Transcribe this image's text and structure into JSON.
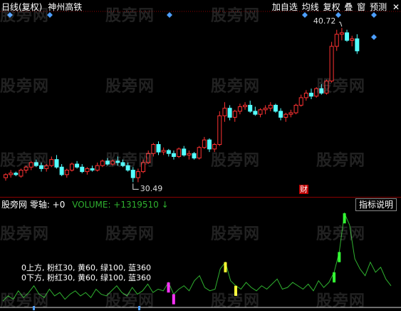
{
  "topbar": {
    "period": "日线(复权)",
    "stock_name": "神州高铁",
    "menu": [
      "加自选",
      "均线",
      "复权",
      "叠",
      "窗",
      "预测"
    ],
    "close": "✕"
  },
  "price": {
    "high_label": "40.72",
    "low_label": "30.49",
    "cai_label": "财"
  },
  "indicator": {
    "name": "股旁网 零轴: +0",
    "volume": "VOLUME: +1319510 ↓",
    "button": "指标说明",
    "legend_line1": "0上方,  粉红30, 黄60, 绿100, 蓝360",
    "legend_line2": "0下方,  粉红30, 黄60, 绿100, 蓝360"
  },
  "watermark": "股旁网",
  "colors": {
    "up": "#ff3232",
    "down": "#54ffff",
    "line": "#2fb12f",
    "diamond": "#4d9fff"
  },
  "chart_data": {
    "type": "candlestick",
    "title": "神州高铁",
    "candles": [
      [
        30.8,
        31.1,
        30.6,
        31.0
      ],
      [
        31.0,
        31.3,
        30.8,
        31.1
      ],
      [
        31.1,
        31.2,
        30.9,
        31.0
      ],
      [
        30.9,
        31.4,
        30.8,
        31.3
      ],
      [
        31.3,
        31.6,
        31.1,
        31.5
      ],
      [
        31.5,
        31.9,
        31.3,
        31.8
      ],
      [
        31.8,
        32.0,
        31.5,
        31.6
      ],
      [
        31.6,
        31.8,
        31.2,
        31.4
      ],
      [
        31.4,
        31.7,
        31.2,
        31.6
      ],
      [
        31.6,
        32.2,
        31.5,
        32.0
      ],
      [
        32.0,
        32.3,
        31.4,
        31.5
      ],
      [
        31.5,
        31.7,
        30.9,
        31.0
      ],
      [
        31.0,
        31.4,
        30.8,
        31.3
      ],
      [
        31.3,
        31.8,
        31.2,
        31.7
      ],
      [
        31.7,
        31.9,
        31.4,
        31.5
      ],
      [
        31.5,
        31.7,
        31.1,
        31.2
      ],
      [
        31.2,
        31.5,
        31.0,
        31.4
      ],
      [
        31.4,
        31.6,
        31.2,
        31.3
      ],
      [
        31.3,
        31.8,
        31.2,
        31.6
      ],
      [
        31.6,
        32.0,
        31.5,
        31.9
      ],
      [
        31.9,
        32.1,
        31.6,
        31.7
      ],
      [
        31.7,
        32.0,
        31.6,
        31.9
      ],
      [
        31.9,
        32.2,
        31.6,
        31.8
      ],
      [
        31.8,
        32.0,
        31.5,
        31.6
      ],
      [
        31.6,
        31.8,
        31.2,
        31.3
      ],
      [
        31.3,
        31.5,
        30.5,
        30.8
      ],
      [
        30.8,
        31.4,
        30.5,
        31.2
      ],
      [
        31.2,
        32.0,
        31.1,
        31.8
      ],
      [
        31.8,
        32.6,
        31.7,
        32.4
      ],
      [
        32.4,
        33.1,
        32.2,
        33.0
      ],
      [
        33.0,
        33.2,
        32.3,
        32.5
      ],
      [
        32.5,
        32.8,
        32.3,
        32.6
      ],
      [
        32.6,
        32.7,
        32.2,
        32.4
      ],
      [
        32.4,
        32.6,
        32.0,
        32.2
      ],
      [
        32.2,
        32.8,
        32.1,
        32.7
      ],
      [
        32.7,
        32.9,
        32.2,
        32.3
      ],
      [
        32.3,
        32.6,
        32.0,
        32.4
      ],
      [
        32.4,
        32.5,
        32.0,
        32.1
      ],
      [
        32.1,
        32.9,
        32.0,
        32.8
      ],
      [
        32.8,
        33.5,
        32.7,
        33.3
      ],
      [
        33.3,
        33.4,
        32.5,
        32.7
      ],
      [
        32.7,
        33.1,
        32.5,
        33.0
      ],
      [
        33.0,
        35.2,
        32.9,
        34.9
      ],
      [
        34.9,
        35.8,
        34.5,
        35.4
      ],
      [
        35.4,
        35.6,
        34.6,
        34.8
      ],
      [
        34.8,
        35.3,
        34.5,
        35.2
      ],
      [
        35.2,
        35.7,
        35.0,
        35.5
      ],
      [
        35.5,
        35.8,
        35.3,
        35.6
      ],
      [
        35.6,
        35.9,
        35.1,
        35.2
      ],
      [
        35.2,
        35.5,
        34.9,
        35.0
      ],
      [
        35.0,
        35.4,
        34.8,
        35.3
      ],
      [
        35.3,
        35.6,
        35.0,
        35.4
      ],
      [
        35.4,
        35.8,
        35.2,
        35.6
      ],
      [
        35.6,
        35.7,
        35.1,
        35.2
      ],
      [
        35.2,
        35.4,
        34.6,
        34.8
      ],
      [
        34.8,
        35.1,
        34.5,
        35.0
      ],
      [
        35.0,
        35.3,
        34.8,
        35.1
      ],
      [
        35.1,
        35.7,
        35.0,
        35.6
      ],
      [
        35.6,
        36.3,
        35.5,
        36.1
      ],
      [
        36.1,
        36.6,
        35.9,
        36.4
      ],
      [
        36.4,
        36.7,
        36.0,
        36.2
      ],
      [
        36.2,
        36.8,
        36.1,
        36.7
      ],
      [
        36.7,
        37.0,
        36.3,
        36.4
      ],
      [
        36.4,
        37.3,
        36.3,
        37.2
      ],
      [
        37.2,
        39.8,
        37.1,
        39.5
      ],
      [
        39.5,
        40.6,
        39.2,
        40.3
      ],
      [
        40.3,
        40.72,
        39.9,
        40.4
      ],
      [
        40.4,
        40.6,
        39.8,
        39.9
      ],
      [
        39.9,
        40.2,
        39.5,
        40.0
      ],
      [
        40.0,
        40.3,
        39.0,
        39.2
      ]
    ],
    "volume_line": [
      3,
      6,
      4,
      9,
      5,
      8,
      12,
      7,
      5,
      10,
      6,
      8,
      4,
      7,
      9,
      6,
      8,
      5,
      10,
      7,
      6,
      9,
      12,
      8,
      6,
      11,
      7,
      9,
      13,
      8,
      10,
      9,
      14,
      7,
      10,
      12,
      9,
      15,
      18,
      11,
      9,
      10,
      22,
      26,
      15,
      12,
      10,
      14,
      11,
      9,
      12,
      10,
      13,
      16,
      10,
      11,
      14,
      12,
      10,
      13,
      9,
      15,
      11,
      14,
      20,
      32,
      55,
      48,
      28,
      22,
      18,
      26,
      20,
      23,
      16,
      12
    ],
    "ylim": [
      30.0,
      41.2
    ]
  }
}
